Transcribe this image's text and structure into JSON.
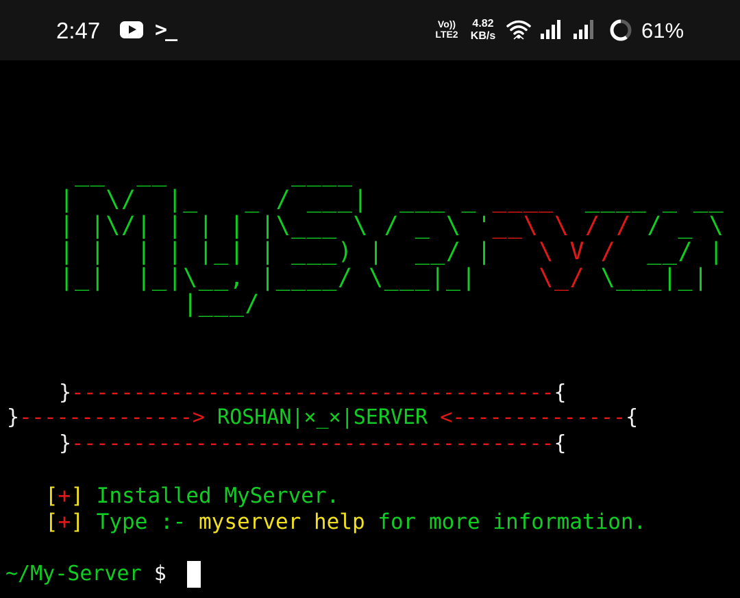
{
  "status_bar": {
    "time": "2:47",
    "terminal_glyph": ">_",
    "volte_top": "Vo))",
    "volte_bottom": "LTE2",
    "speed_value": "4.82",
    "speed_unit": "KB/s",
    "battery_percent": "61%",
    "icons": [
      "youtube-icon",
      "terminal-icon",
      "wifi-icon",
      "signal-icon",
      "signal-icon",
      "battery-ring-icon"
    ]
  },
  "terminal": {
    "logo_lines": [
      "  __  __        ____",
      " |  \\/  |_   _ / ___|  ___ _ ",
      " | |\\/| | | | |\\___ \\ / _ \\ '",
      " | |  | | |_| | ___) |  __/ |",
      " |_|  |_|\\__, |____/ \\___|_|",
      "         |___/"
    ],
    "logo_lines_red": [
      "",
      "____",
      "__\\ \\ / /",
      "   \\ V /",
      "    \\_/",
      ""
    ],
    "logo_lines_tail": [
      "",
      "  ____ _ __",
      " / _ \\ '__|",
      "  __/ |",
      " \\___|_|",
      ""
    ],
    "banner": {
      "top_left": "}",
      "top_dashes": "---------------------------------------",
      "top_right": "{",
      "mid_left": "}",
      "mid_dashes_left": "-------------->",
      "title": " ROSHAN|×_×|SERVER ",
      "mid_dashes_right": "<--------------",
      "mid_right": "{",
      "bot_left": "}",
      "bot_dashes": "---------------------------------------",
      "bot_right": "{"
    },
    "info_lines": [
      {
        "open": "[",
        "plus": "+",
        "close": "]",
        "text": " Installed MyServer.",
        "cmd": "",
        "tail": ""
      },
      {
        "open": "[",
        "plus": "+",
        "close": "]",
        "text": " Type :- ",
        "cmd": "myserver help",
        "tail": " for more information."
      }
    ],
    "prompt": {
      "path": "~/My-Server",
      "symbol": " $ "
    }
  },
  "colors": {
    "green": "#11cc22",
    "red": "#e01818",
    "yellow": "#f0e020",
    "white": "#f2f2f2",
    "background": "#000000",
    "status_bar": "#141414"
  }
}
